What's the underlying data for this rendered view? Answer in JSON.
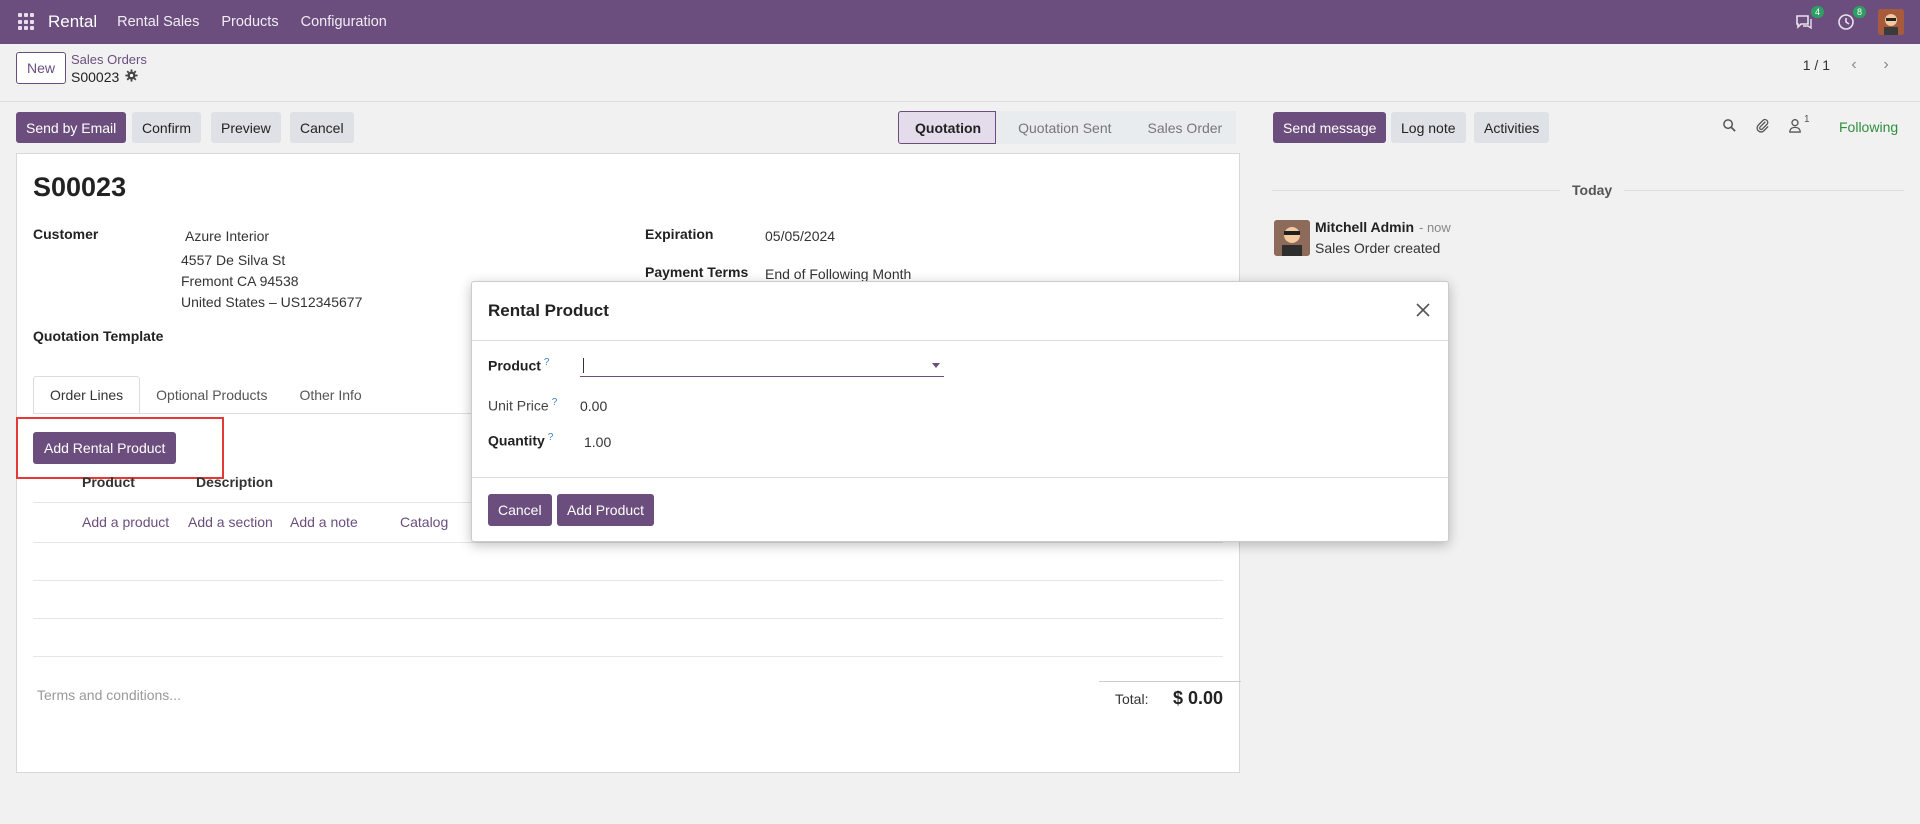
{
  "navbar": {
    "brand": "Rental",
    "menu": [
      "Rental Sales",
      "Products",
      "Configuration"
    ],
    "messages_badge": "4",
    "activities_badge": "8"
  },
  "control": {
    "new_label": "New",
    "breadcrumb_parent": "Sales Orders",
    "breadcrumb_current": "S00023",
    "pager": "1 / 1"
  },
  "actions": {
    "send_email": "Send by Email",
    "confirm": "Confirm",
    "preview": "Preview",
    "cancel": "Cancel"
  },
  "status": {
    "stages": [
      "Quotation",
      "Quotation Sent",
      "Sales Order"
    ],
    "active": "Quotation"
  },
  "form": {
    "title": "S00023",
    "customer_label": "Customer",
    "customer_name": "Azure Interior",
    "address_line1": "4557 De Silva St",
    "address_line2": "Fremont CA 94538",
    "address_line3": "United States – US12345677",
    "expiration_label": "Expiration",
    "expiration_value": "05/05/2024",
    "payment_terms_label": "Payment Terms",
    "payment_terms_value": "End of Following Month",
    "template_label": "Quotation Template",
    "tabs": [
      "Order Lines",
      "Optional Products",
      "Other Info"
    ],
    "add_rental_label": "Add Rental Product",
    "col_product": "Product",
    "col_description": "Description",
    "add_product": "Add a product",
    "add_section": "Add a section",
    "add_note": "Add a note",
    "catalog": "Catalog",
    "terms_placeholder": "Terms and conditions...",
    "total_label": "Total:",
    "total_value": "$ 0.00"
  },
  "chatter": {
    "send_message": "Send message",
    "log_note": "Log note",
    "activities": "Activities",
    "followers_count": "1",
    "following": "Following",
    "today": "Today",
    "author": "Mitchell Admin",
    "time": "- now",
    "body": "Sales Order created"
  },
  "modal": {
    "title": "Rental Product",
    "product_label": "Product",
    "product_value": "",
    "unit_price_label": "Unit Price",
    "unit_price_value": "0.00",
    "quantity_label": "Quantity",
    "quantity_value": "1.00",
    "help_mark": "?",
    "cancel_label": "Cancel",
    "add_label": "Add Product"
  },
  "colors": {
    "brand": "#6b4e7e",
    "following": "#2f8f3e",
    "highlight": "#e53935"
  }
}
